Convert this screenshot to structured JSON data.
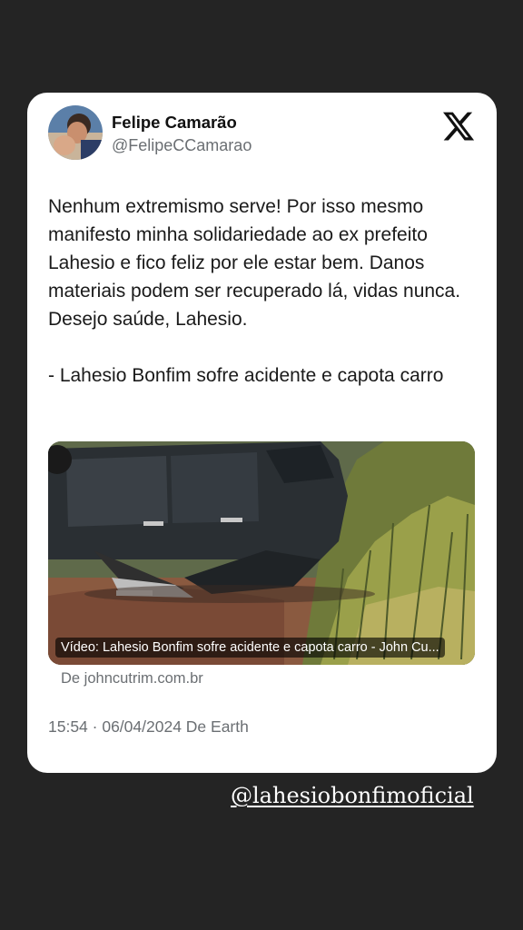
{
  "post": {
    "author_name": "Felipe Camarão",
    "author_handle": "@FelipeCCamarao",
    "platform_icon": "x-logo-icon",
    "text": "Nenhum extremismo serve! Por isso mesmo manifesto minha solidariedade ao ex prefeito Lahesio e fico feliz por ele estar bem. Danos materiais podem ser recuperado lá, vidas nunca. Desejo saúde, Lahesio.\n\n- Lahesio Bonfim sofre acidente e capota carro",
    "link_card": {
      "caption": "Vídeo: Lahesio Bonfim sofre acidente e capota carro - John Cu...",
      "source": "De johncutrim.com.br"
    },
    "meta": "15:54 · 06/04/2024 De Earth"
  },
  "story": {
    "mention": "@lahesiobonfimoficial"
  },
  "colors": {
    "background": "#242424",
    "card": "#ffffff",
    "secondary_text": "#6b6f73"
  }
}
